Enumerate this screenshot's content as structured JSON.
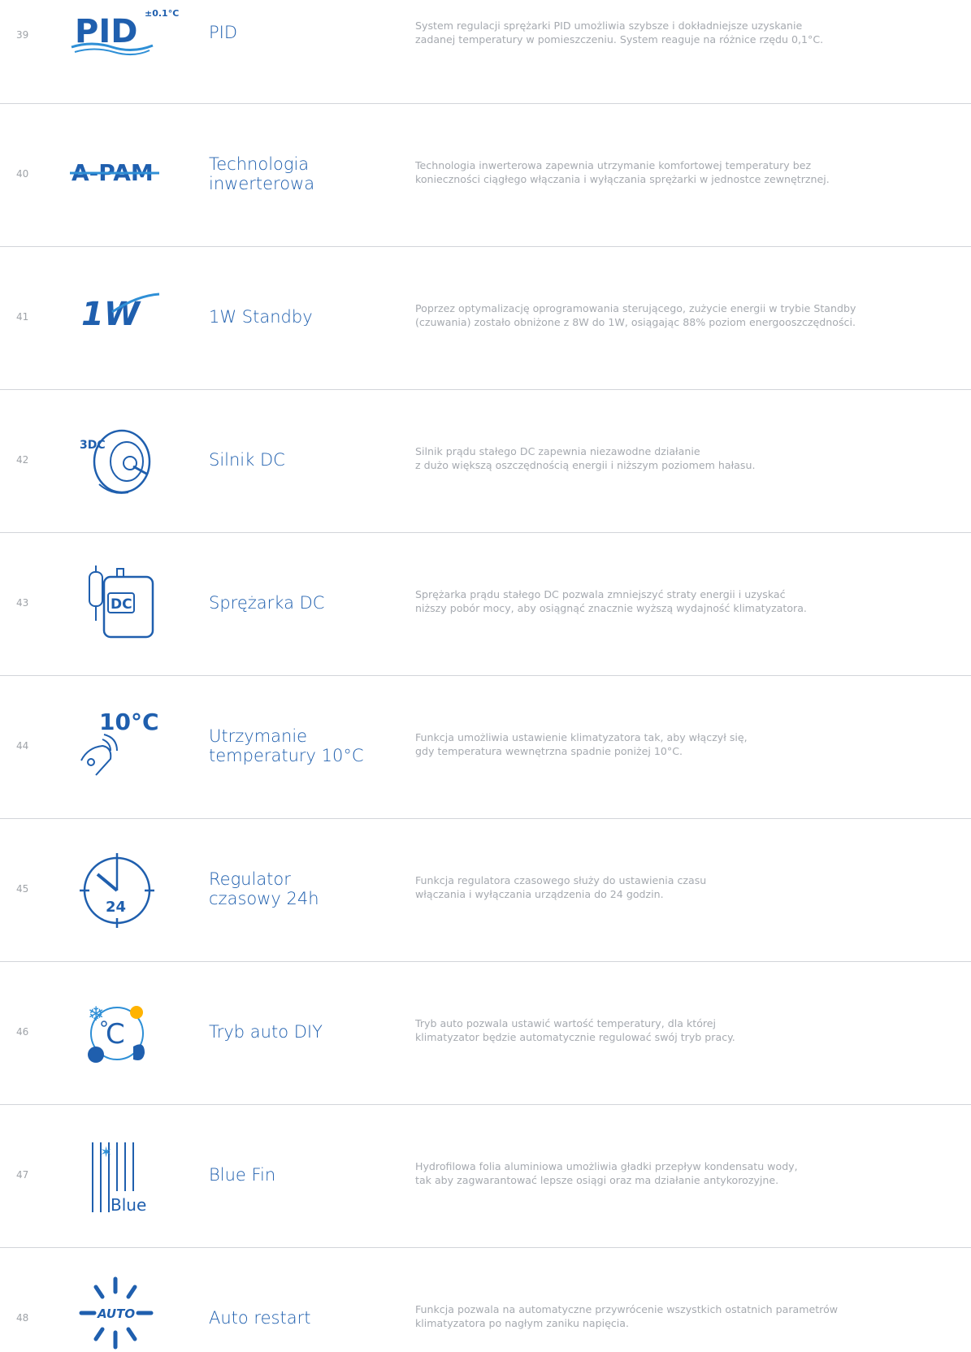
{
  "features": [
    {
      "number": "39",
      "name": [
        "PID"
      ],
      "icon": "pid-temperature-icon",
      "icon_text": {
        "main": "PID",
        "sup": "±0.1°C"
      },
      "description": [
        "System regulacji sprężarki PID umożliwia szybsze i dokładniejsze uzyskanie",
        "zadanej temperatury w pomieszczeniu. System reaguje na różnice rzędu 0,1°C."
      ]
    },
    {
      "number": "40",
      "name": [
        "Technologia",
        "inwerterowa"
      ],
      "icon": "a-pam-inverter-icon",
      "icon_text": {
        "main": "A-PAM"
      },
      "description": [
        "Technologia inwerterowa zapewnia utrzymanie komfortowej temperatury bez",
        "konieczności ciągłego włączania i wyłączania sprężarki w jednostce zewnętrznej."
      ]
    },
    {
      "number": "41",
      "name": [
        "1W Standby"
      ],
      "icon": "1w-standby-icon",
      "icon_text": {
        "main": "1W"
      },
      "description": [
        "Poprzez optymalizację oprogramowania sterującego, zużycie energii w trybie Standby",
        "(czuwania) zostało obniżone z 8W do 1W, osiągając 88% poziom energooszczędności."
      ]
    },
    {
      "number": "42",
      "name": [
        "Silnik DC"
      ],
      "icon": "dc-motor-icon",
      "icon_text": {
        "main": "3DC"
      },
      "description": [
        "Silnik prądu stałego DC zapewnia niezawodne działanie",
        "z dużo większą oszczędnością energii i niższym poziomem hałasu."
      ]
    },
    {
      "number": "43",
      "name": [
        "Sprężarka DC"
      ],
      "icon": "dc-compressor-icon",
      "icon_text": {
        "main": "DC"
      },
      "description": [
        "Sprężarka prądu stałego DC pozwala zmniejszyć straty energii i uzyskać",
        "niższy pobór mocy, aby osiągnąć znacznie wyższą wydajność klimatyzatora."
      ]
    },
    {
      "number": "44",
      "name": [
        "Utrzymanie",
        "temperatury 10°C"
      ],
      "icon": "10c-heating-icon",
      "icon_text": {
        "main": "10°C"
      },
      "description": [
        "Funkcja umożliwia ustawienie klimatyzatora tak, aby włączył się,",
        "gdy temperatura wewnętrzna spadnie poniżej 10°C."
      ]
    },
    {
      "number": "45",
      "name": [
        "Regulator",
        "czasowy 24h"
      ],
      "icon": "24h-timer-clock-icon",
      "icon_text": {
        "main": "24"
      },
      "description": [
        "Funkcja regulatora czasowego służy do ustawienia czasu",
        "włączania i wyłączania urządzenia do 24 godzin."
      ]
    },
    {
      "number": "46",
      "name": [
        "Tryb auto DIY"
      ],
      "icon": "auto-mode-icon",
      "icon_text": {
        "main": "C"
      },
      "description": [
        "Tryb auto pozwala ustawić wartość temperatury, dla której",
        "klimatyzator będzie automatycznie regulować swój tryb pracy."
      ]
    },
    {
      "number": "47",
      "name": [
        "Blue Fin"
      ],
      "icon": "blue-fin-icon",
      "icon_text": {
        "main": "Blue"
      },
      "description": [
        "Hydrofilowa folia aluminiowa umożliwia gładki przepływ kondensatu wody,",
        "tak aby zagwarantować lepsze osiągi oraz ma działanie antykorozyjne."
      ]
    },
    {
      "number": "48",
      "name": [
        "Auto restart"
      ],
      "icon": "auto-restart-icon",
      "icon_text": {
        "main": "AUTO"
      },
      "description": [
        "Funkcja pozwala na automatyczne przywrócenie wszystkich ostatnich parametrów",
        "klimatyzatora po nagłym zaniku napięcia."
      ]
    }
  ],
  "colors": {
    "brand_blue": "#1f5fae",
    "light_blue": "#2e8fd6",
    "text_gray": "#a6aab0",
    "divider": "#d2d5d9"
  }
}
